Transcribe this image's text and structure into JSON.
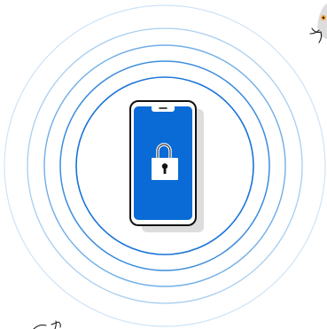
{
  "illustration": {
    "subject": "phone-lock",
    "icons": {
      "phone": "smartphone-icon",
      "lock": "padlock-icon",
      "signal": "signal-rings-icon",
      "peek": "cartoon-peeking-character-icon",
      "doodle": "scribble-doodle-icon"
    },
    "colors": {
      "background": "#ffffff",
      "screen": "#0a6bd6",
      "phone_body": "#ffffff",
      "outline": "#111111",
      "shadow": "#dddddd",
      "lock": "#ffffff",
      "keyhole": "#111111",
      "rings": [
        "#0a62c9",
        "#1a73d6",
        "#3d8ddc",
        "#70aee6",
        "#a6cdef",
        "#cfe3f6"
      ],
      "accent": "#f2a33a"
    }
  }
}
